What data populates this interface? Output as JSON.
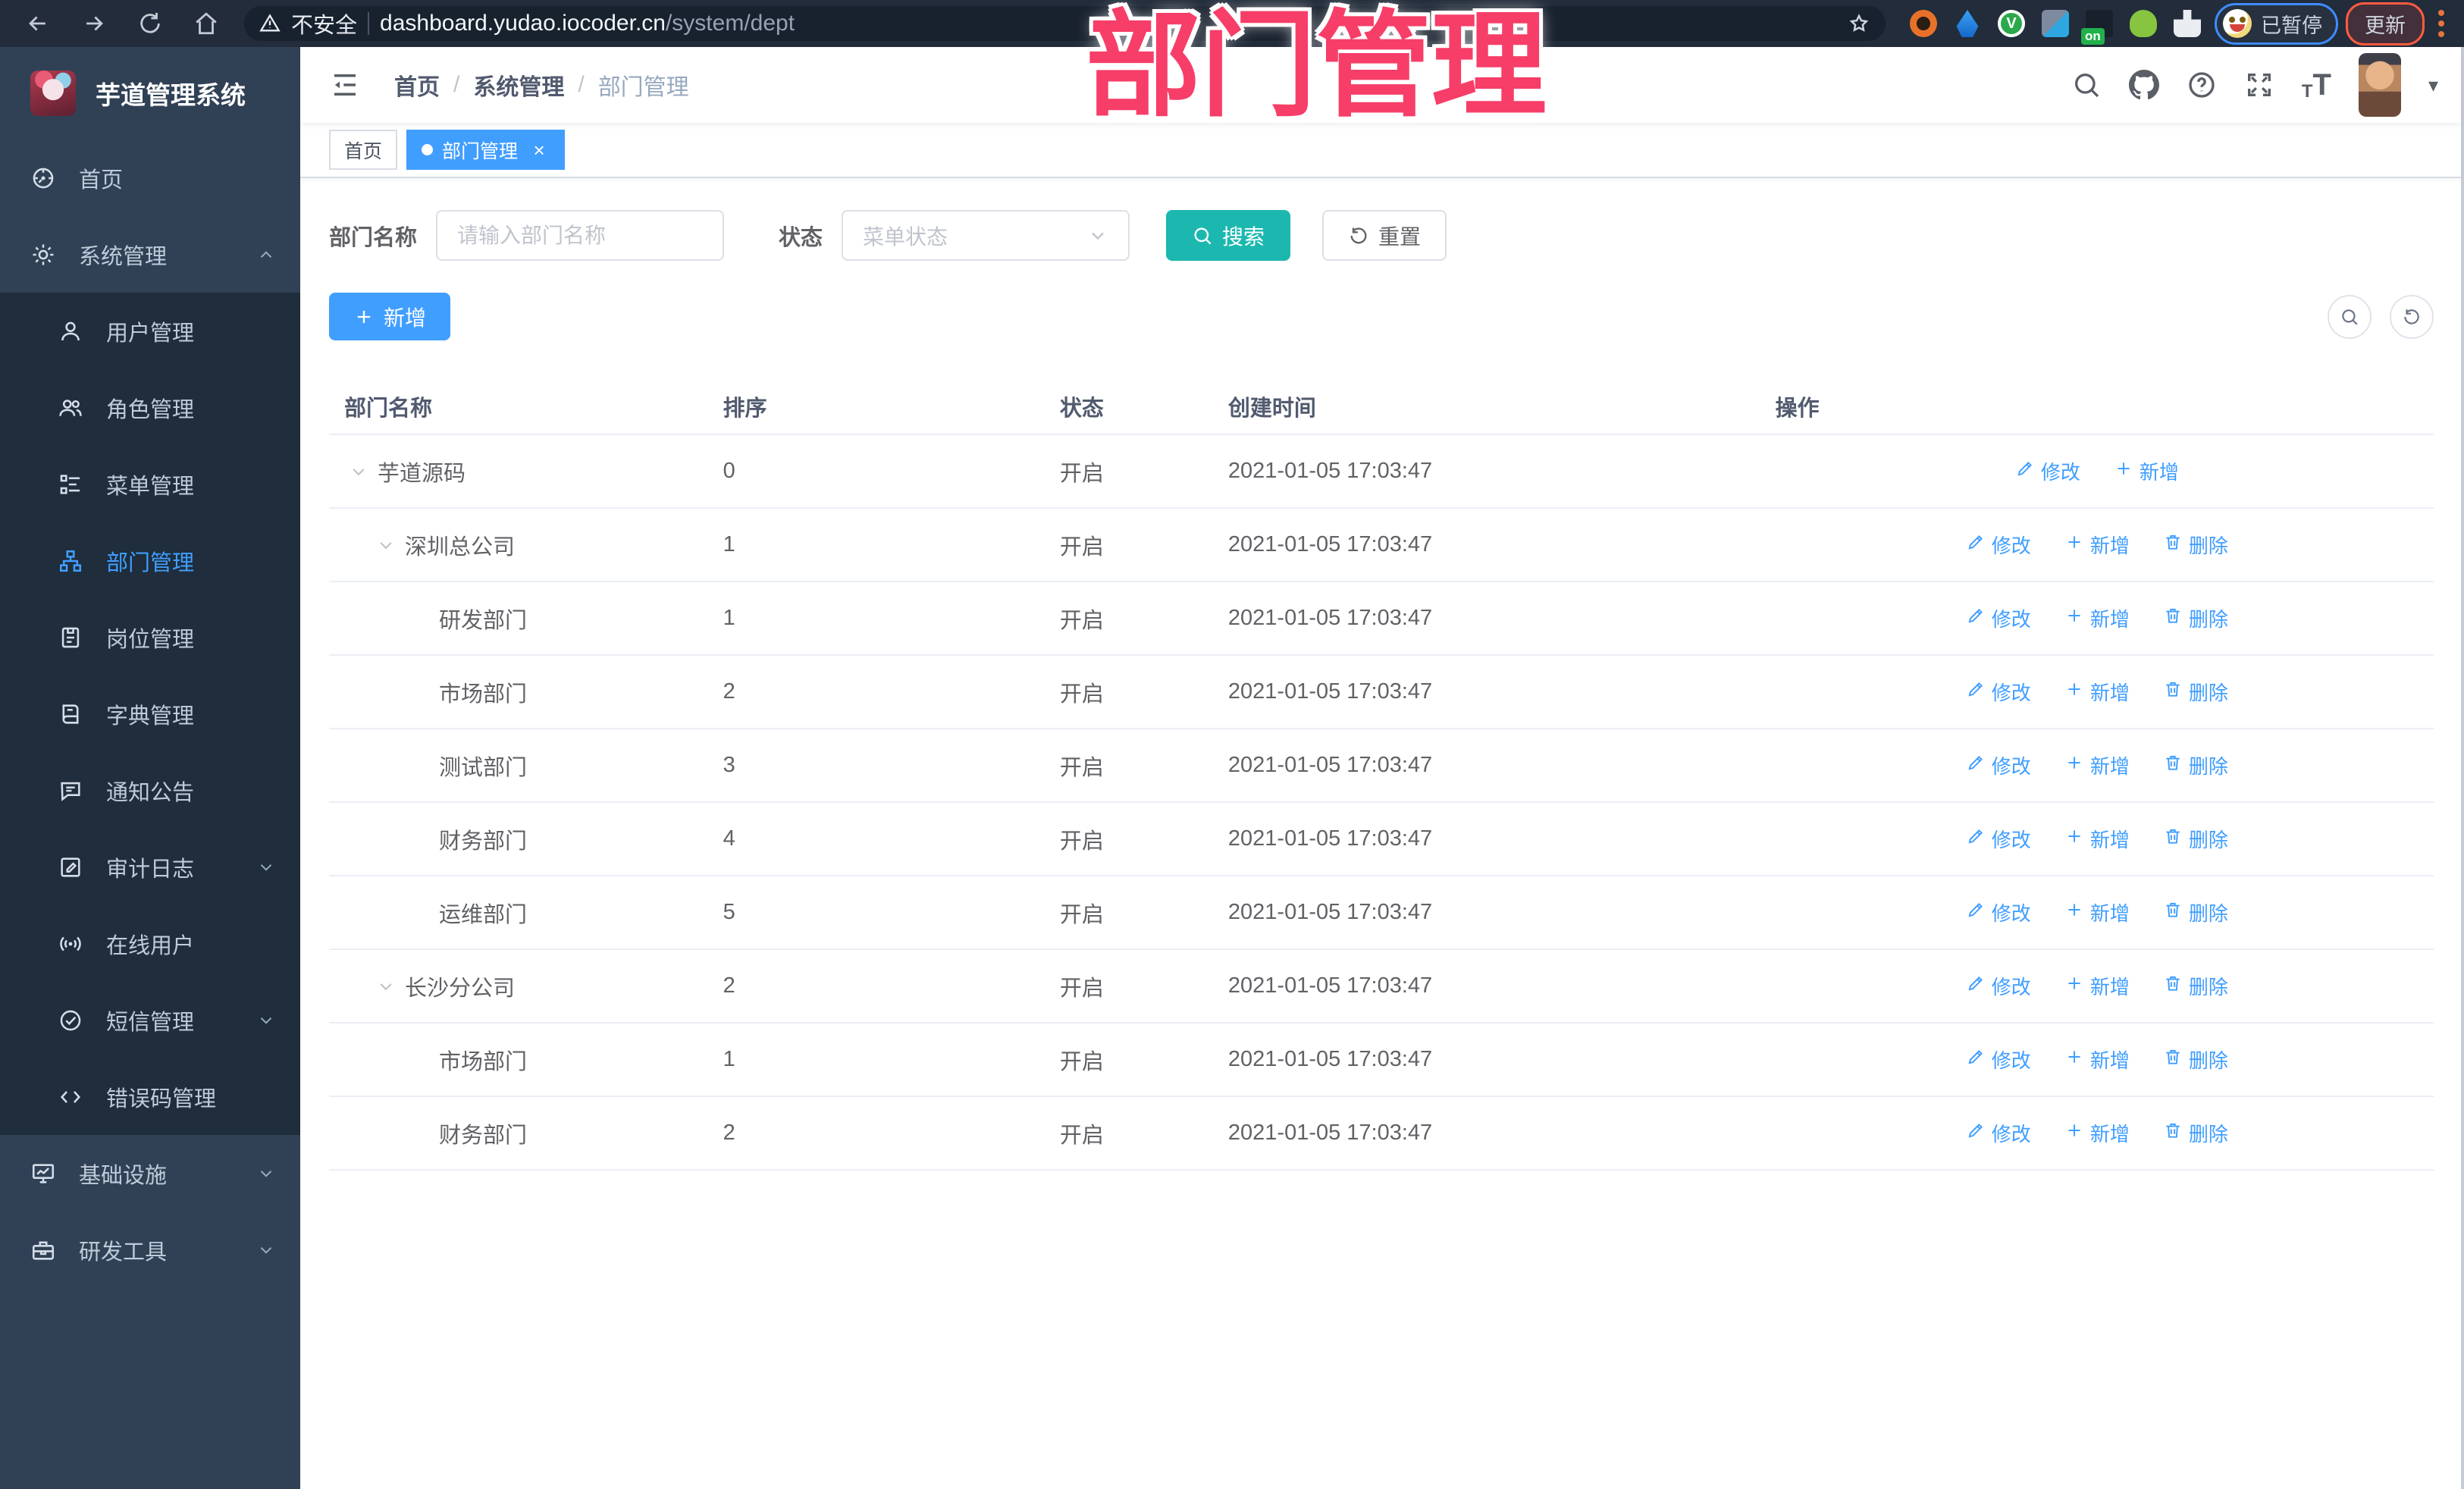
{
  "browser": {
    "not_secure_label": "不安全",
    "url_host": "dashboard.yudao.iocoder.cn",
    "url_path": "/system/dept",
    "paused_badge": "已暂停",
    "update_button": "更新"
  },
  "overlay": {
    "title": "部门管理",
    "color": "#f63e68"
  },
  "sidebar": {
    "logo_title": "芋道管理系统",
    "items": [
      {
        "key": "home",
        "label": "首页",
        "icon": "dashboard-icon",
        "type": "root"
      },
      {
        "key": "system",
        "label": "系统管理",
        "icon": "gear-icon",
        "type": "root",
        "chevron": "up"
      },
      {
        "key": "users",
        "label": "用户管理",
        "icon": "user-icon",
        "type": "sub"
      },
      {
        "key": "roles",
        "label": "角色管理",
        "icon": "users-icon",
        "type": "sub"
      },
      {
        "key": "menus",
        "label": "菜单管理",
        "icon": "menu-tree-icon",
        "type": "sub"
      },
      {
        "key": "depts",
        "label": "部门管理",
        "icon": "org-chart-icon",
        "type": "sub",
        "active": true
      },
      {
        "key": "posts",
        "label": "岗位管理",
        "icon": "badge-icon",
        "type": "sub"
      },
      {
        "key": "dicts",
        "label": "字典管理",
        "icon": "book-icon",
        "type": "sub"
      },
      {
        "key": "notices",
        "label": "通知公告",
        "icon": "announcement-icon",
        "type": "sub"
      },
      {
        "key": "audit-logs",
        "label": "审计日志",
        "icon": "log-icon",
        "type": "sub",
        "chevron": "down"
      },
      {
        "key": "online-users",
        "label": "在线用户",
        "icon": "broadcast-icon",
        "type": "sub"
      },
      {
        "key": "sms",
        "label": "短信管理",
        "icon": "check-circle-icon",
        "type": "sub",
        "chevron": "down"
      },
      {
        "key": "error-codes",
        "label": "错误码管理",
        "icon": "code-icon",
        "type": "sub"
      },
      {
        "key": "infra",
        "label": "基础设施",
        "icon": "monitor-chart-icon",
        "type": "root",
        "chevron": "down"
      },
      {
        "key": "dev-tools",
        "label": "研发工具",
        "icon": "toolbox-icon",
        "type": "root",
        "chevron": "down"
      }
    ]
  },
  "header": {
    "breadcrumb": [
      "首页",
      "系统管理",
      "部门管理"
    ]
  },
  "tags": [
    {
      "label": "首页",
      "active": false,
      "closable": false
    },
    {
      "label": "部门管理",
      "active": true,
      "closable": true
    }
  ],
  "filters": {
    "dept_label": "部门名称",
    "dept_placeholder": "请输入部门名称",
    "status_label": "状态",
    "status_placeholder": "菜单状态",
    "search_label": "搜索",
    "reset_label": "重置"
  },
  "toolbar": {
    "add_label": "新增"
  },
  "actions": {
    "edit": "修改",
    "add": "新增",
    "delete": "删除"
  },
  "table": {
    "columns": [
      "部门名称",
      "排序",
      "状态",
      "创建时间",
      "操作"
    ],
    "rows": [
      {
        "name": "芋道源码",
        "level": 0,
        "caret": true,
        "sort": "0",
        "status": "开启",
        "time": "2021-01-05 17:03:47",
        "can_delete": false
      },
      {
        "name": "深圳总公司",
        "level": 1,
        "caret": true,
        "sort": "1",
        "status": "开启",
        "time": "2021-01-05 17:03:47",
        "can_delete": true
      },
      {
        "name": "研发部门",
        "level": 2,
        "caret": false,
        "sort": "1",
        "status": "开启",
        "time": "2021-01-05 17:03:47",
        "can_delete": true
      },
      {
        "name": "市场部门",
        "level": 2,
        "caret": false,
        "sort": "2",
        "status": "开启",
        "time": "2021-01-05 17:03:47",
        "can_delete": true
      },
      {
        "name": "测试部门",
        "level": 2,
        "caret": false,
        "sort": "3",
        "status": "开启",
        "time": "2021-01-05 17:03:47",
        "can_delete": true
      },
      {
        "name": "财务部门",
        "level": 2,
        "caret": false,
        "sort": "4",
        "status": "开启",
        "time": "2021-01-05 17:03:47",
        "can_delete": true
      },
      {
        "name": "运维部门",
        "level": 2,
        "caret": false,
        "sort": "5",
        "status": "开启",
        "time": "2021-01-05 17:03:47",
        "can_delete": true
      },
      {
        "name": "长沙分公司",
        "level": 1,
        "caret": true,
        "sort": "2",
        "status": "开启",
        "time": "2021-01-05 17:03:47",
        "can_delete": true
      },
      {
        "name": "市场部门",
        "level": 2,
        "caret": false,
        "sort": "1",
        "status": "开启",
        "time": "2021-01-05 17:03:47",
        "can_delete": true
      },
      {
        "name": "财务部门",
        "level": 2,
        "caret": false,
        "sort": "2",
        "status": "开启",
        "time": "2021-01-05 17:03:47",
        "can_delete": true
      }
    ]
  },
  "colors": {
    "accent_blue": "#409eff",
    "search_teal": "#1cb8b0",
    "sidebar_bg": "#304156",
    "submenu_bg": "#1f2d3d",
    "annotation_pink": "#f63e68"
  }
}
